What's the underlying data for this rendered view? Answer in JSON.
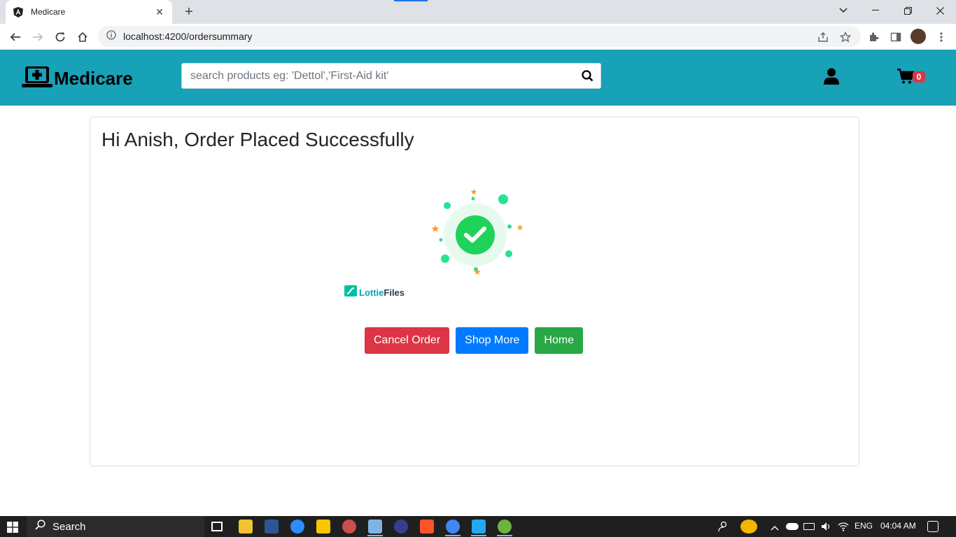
{
  "browser": {
    "tab_title": "Medicare",
    "url": "localhost:4200/ordersummary"
  },
  "header": {
    "brand": "Medicare",
    "search_placeholder": "search products eg: 'Dettol','First-Aid kit'",
    "cart_count": "0",
    "bg_color": "#17a2b8"
  },
  "main": {
    "title": "Hi Anish, Order Placed Successfully",
    "lottie_brand_a": "Lottie",
    "lottie_brand_b": "Files",
    "buttons": {
      "cancel": "Cancel Order",
      "shop": "Shop More",
      "home": "Home"
    }
  },
  "taskbar": {
    "search_label": "Search",
    "language": "ENG",
    "time": "04:04 AM"
  },
  "colors": {
    "danger": "#dc3545",
    "primary": "#007bff",
    "success": "#28a745"
  }
}
